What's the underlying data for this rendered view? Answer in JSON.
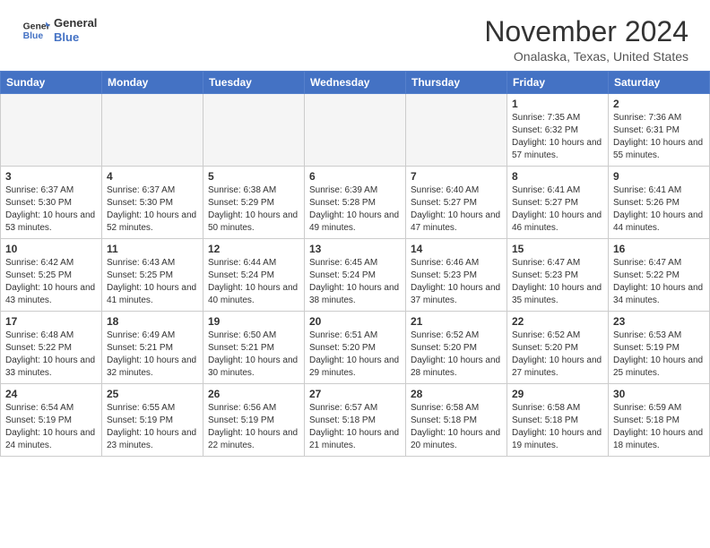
{
  "header": {
    "logo_line1": "General",
    "logo_line2": "Blue",
    "month": "November 2024",
    "location": "Onalaska, Texas, United States"
  },
  "weekdays": [
    "Sunday",
    "Monday",
    "Tuesday",
    "Wednesday",
    "Thursday",
    "Friday",
    "Saturday"
  ],
  "weeks": [
    [
      {
        "day": "",
        "empty": true
      },
      {
        "day": "",
        "empty": true
      },
      {
        "day": "",
        "empty": true
      },
      {
        "day": "",
        "empty": true
      },
      {
        "day": "",
        "empty": true
      },
      {
        "day": "1",
        "sunrise": "7:35 AM",
        "sunset": "6:32 PM",
        "daylight": "10 hours and 57 minutes."
      },
      {
        "day": "2",
        "sunrise": "7:36 AM",
        "sunset": "6:31 PM",
        "daylight": "10 hours and 55 minutes."
      }
    ],
    [
      {
        "day": "3",
        "sunrise": "6:37 AM",
        "sunset": "5:30 PM",
        "daylight": "10 hours and 53 minutes."
      },
      {
        "day": "4",
        "sunrise": "6:37 AM",
        "sunset": "5:30 PM",
        "daylight": "10 hours and 52 minutes."
      },
      {
        "day": "5",
        "sunrise": "6:38 AM",
        "sunset": "5:29 PM",
        "daylight": "10 hours and 50 minutes."
      },
      {
        "day": "6",
        "sunrise": "6:39 AM",
        "sunset": "5:28 PM",
        "daylight": "10 hours and 49 minutes."
      },
      {
        "day": "7",
        "sunrise": "6:40 AM",
        "sunset": "5:27 PM",
        "daylight": "10 hours and 47 minutes."
      },
      {
        "day": "8",
        "sunrise": "6:41 AM",
        "sunset": "5:27 PM",
        "daylight": "10 hours and 46 minutes."
      },
      {
        "day": "9",
        "sunrise": "6:41 AM",
        "sunset": "5:26 PM",
        "daylight": "10 hours and 44 minutes."
      }
    ],
    [
      {
        "day": "10",
        "sunrise": "6:42 AM",
        "sunset": "5:25 PM",
        "daylight": "10 hours and 43 minutes."
      },
      {
        "day": "11",
        "sunrise": "6:43 AM",
        "sunset": "5:25 PM",
        "daylight": "10 hours and 41 minutes."
      },
      {
        "day": "12",
        "sunrise": "6:44 AM",
        "sunset": "5:24 PM",
        "daylight": "10 hours and 40 minutes."
      },
      {
        "day": "13",
        "sunrise": "6:45 AM",
        "sunset": "5:24 PM",
        "daylight": "10 hours and 38 minutes."
      },
      {
        "day": "14",
        "sunrise": "6:46 AM",
        "sunset": "5:23 PM",
        "daylight": "10 hours and 37 minutes."
      },
      {
        "day": "15",
        "sunrise": "6:47 AM",
        "sunset": "5:23 PM",
        "daylight": "10 hours and 35 minutes."
      },
      {
        "day": "16",
        "sunrise": "6:47 AM",
        "sunset": "5:22 PM",
        "daylight": "10 hours and 34 minutes."
      }
    ],
    [
      {
        "day": "17",
        "sunrise": "6:48 AM",
        "sunset": "5:22 PM",
        "daylight": "10 hours and 33 minutes."
      },
      {
        "day": "18",
        "sunrise": "6:49 AM",
        "sunset": "5:21 PM",
        "daylight": "10 hours and 32 minutes."
      },
      {
        "day": "19",
        "sunrise": "6:50 AM",
        "sunset": "5:21 PM",
        "daylight": "10 hours and 30 minutes."
      },
      {
        "day": "20",
        "sunrise": "6:51 AM",
        "sunset": "5:20 PM",
        "daylight": "10 hours and 29 minutes."
      },
      {
        "day": "21",
        "sunrise": "6:52 AM",
        "sunset": "5:20 PM",
        "daylight": "10 hours and 28 minutes."
      },
      {
        "day": "22",
        "sunrise": "6:52 AM",
        "sunset": "5:20 PM",
        "daylight": "10 hours and 27 minutes."
      },
      {
        "day": "23",
        "sunrise": "6:53 AM",
        "sunset": "5:19 PM",
        "daylight": "10 hours and 25 minutes."
      }
    ],
    [
      {
        "day": "24",
        "sunrise": "6:54 AM",
        "sunset": "5:19 PM",
        "daylight": "10 hours and 24 minutes."
      },
      {
        "day": "25",
        "sunrise": "6:55 AM",
        "sunset": "5:19 PM",
        "daylight": "10 hours and 23 minutes."
      },
      {
        "day": "26",
        "sunrise": "6:56 AM",
        "sunset": "5:19 PM",
        "daylight": "10 hours and 22 minutes."
      },
      {
        "day": "27",
        "sunrise": "6:57 AM",
        "sunset": "5:18 PM",
        "daylight": "10 hours and 21 minutes."
      },
      {
        "day": "28",
        "sunrise": "6:58 AM",
        "sunset": "5:18 PM",
        "daylight": "10 hours and 20 minutes."
      },
      {
        "day": "29",
        "sunrise": "6:58 AM",
        "sunset": "5:18 PM",
        "daylight": "10 hours and 19 minutes."
      },
      {
        "day": "30",
        "sunrise": "6:59 AM",
        "sunset": "5:18 PM",
        "daylight": "10 hours and 18 minutes."
      }
    ]
  ]
}
